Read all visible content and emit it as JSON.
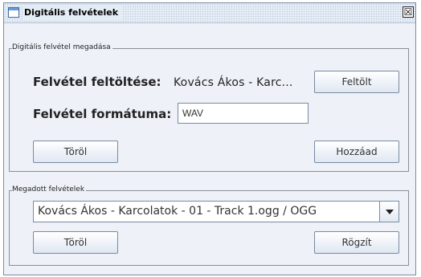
{
  "window": {
    "title": "Digitális felvételek",
    "close_glyph": "☒"
  },
  "input_panel": {
    "legend": "Digitális felvétel megadása",
    "upload_label": "Felvétel feltöltése:",
    "upload_value": "Kovács Ákos - Karc...",
    "upload_button": "Feltölt",
    "format_label": "Felvétel formátuma:",
    "format_value": "WAV",
    "delete_button": "Töröl",
    "add_button": "Hozzáad"
  },
  "list_panel": {
    "legend": "Megadott felvételek",
    "selected_recording": "Kovács Ákos - Karcolatok - 01 - Track  1.ogg / OGG",
    "delete_button": "Töröl",
    "save_button": "Rögzít"
  }
}
